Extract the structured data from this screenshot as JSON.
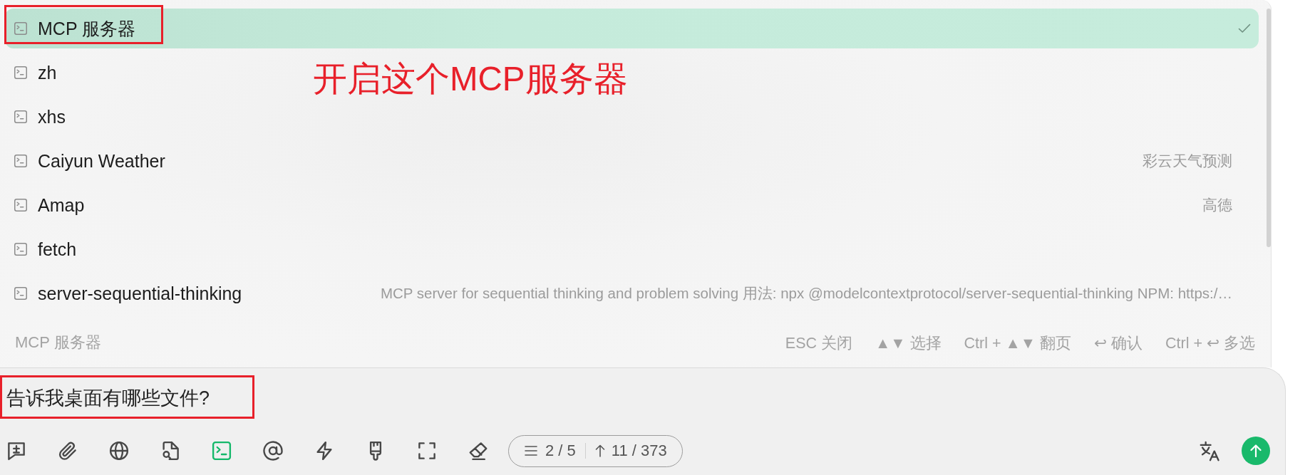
{
  "server_list": {
    "items": [
      {
        "name": "MCP 服务器",
        "selected": true,
        "highlighted": true
      },
      {
        "name": "zh",
        "selected": false,
        "highlighted": false
      },
      {
        "name": "xhs",
        "selected": false,
        "highlighted": false
      },
      {
        "name": "Caiyun Weather",
        "description": "彩云天气预测",
        "selected": false,
        "highlighted": false
      },
      {
        "name": "Amap",
        "description": "高德",
        "selected": false,
        "highlighted": false
      },
      {
        "name": "fetch",
        "selected": false,
        "highlighted": false
      },
      {
        "name": "server-sequential-thinking",
        "description": "MCP server for sequential thinking and problem solving 用法: npx @modelcontextprotocol/server-sequential-thinking NPM: https:/…",
        "selected": false,
        "highlighted": false
      }
    ]
  },
  "callout": {
    "text": "开启这个MCP服务器"
  },
  "footer": {
    "title": "MCP 服务器",
    "hints": [
      "ESC 关闭",
      "▲▼ 选择",
      "Ctrl + ▲▼ 翻页",
      "↩ 确认",
      "Ctrl + ↩ 多选"
    ]
  },
  "composer": {
    "value": "告诉我桌面有哪些文件?",
    "highlighted": true,
    "tools": [
      {
        "kind": "chat",
        "active": false
      },
      {
        "kind": "attach",
        "active": false
      },
      {
        "kind": "web",
        "active": false
      },
      {
        "kind": "knowledge",
        "active": false
      },
      {
        "kind": "mcp",
        "active": true
      },
      {
        "kind": "mention",
        "active": false
      },
      {
        "kind": "quick",
        "active": false
      },
      {
        "kind": "brush",
        "active": false
      },
      {
        "kind": "expand",
        "active": false
      },
      {
        "kind": "clear",
        "active": false
      }
    ],
    "context": {
      "messages": "2 / 5",
      "tokens": "11 / 373"
    }
  }
}
